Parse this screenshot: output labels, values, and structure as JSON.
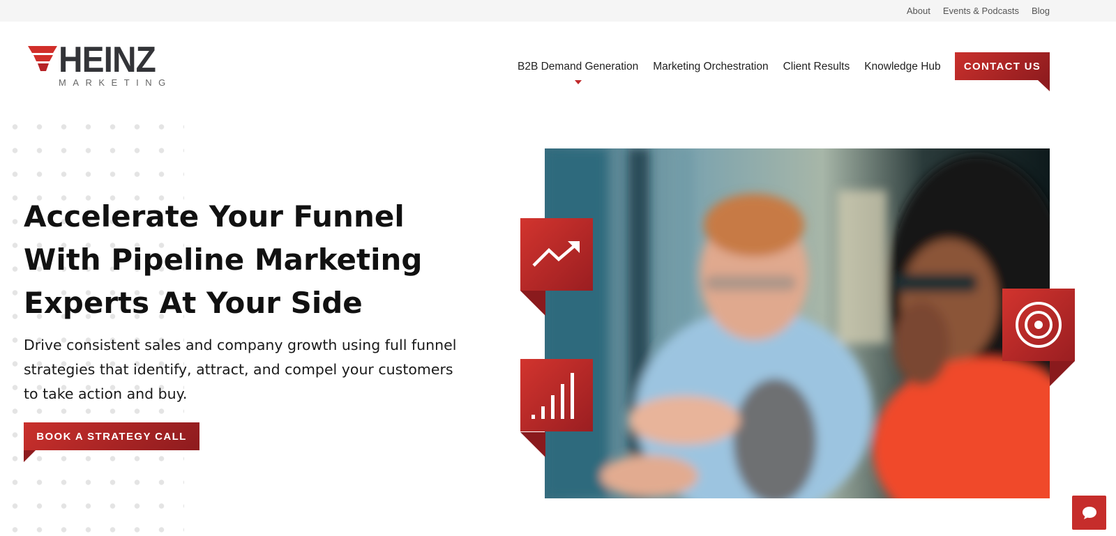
{
  "utility_nav": [
    "About",
    "Events & Podcasts",
    "Blog"
  ],
  "logo": {
    "word": "HEINZ",
    "sub": "MARKETING"
  },
  "main_nav": [
    "B2B Demand Generation",
    "Marketing Orchestration",
    "Client Results",
    "Knowledge Hub"
  ],
  "contact_label": "CONTACT US",
  "hero": {
    "title": "Accelerate Your Funnel With Pipeline Marketing Experts At Your Side",
    "subtitle": "Drive consistent sales and company growth using full funnel strategies that identify, attract, and compel your customers to take action and buy.",
    "cta_label": "BOOK A STRATEGY CALL"
  },
  "icons": {
    "tile_1": "trend-up-icon",
    "tile_2": "signal-bars-icon",
    "tile_3": "target-icon",
    "chat": "chat-bubble-icon"
  },
  "colors": {
    "brand_red": "#c9302c",
    "brand_red_dark": "#8e1b1e",
    "text": "#111111",
    "utility_bg": "#f5f5f5"
  }
}
